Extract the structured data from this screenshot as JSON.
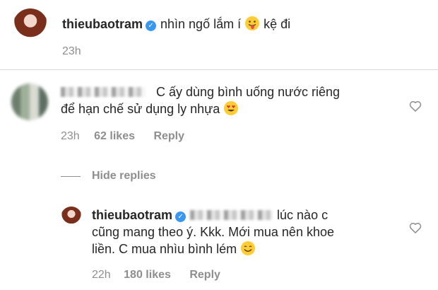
{
  "post_comment": {
    "username": "thieubaotram",
    "text_before_emoji": "nhìn ngố lắm í",
    "text_after_emoji": "kệ đi",
    "time": "23h"
  },
  "reply_comment": {
    "text_line1": "C ấy dùng bình uống nước riêng",
    "text_line2": "để hạn chế sử dụng ly nhựa",
    "time": "23h",
    "likes": "62 likes",
    "reply_label": "Reply",
    "hide_replies": "Hide replies"
  },
  "nested_reply": {
    "username": "thieubaotram",
    "text_line1_tail": "lúc nào c",
    "text_line2": "cũng mang theo ý. Kkk. Mới mua nên khoe",
    "text_line3": "liền. C mua nhìu bình lém",
    "time": "22h",
    "likes": "180 likes",
    "reply_label": "Reply"
  },
  "icons": {
    "verified": "✓",
    "heart": "heart-outline-icon",
    "emoji_tongue": "tongue-out-face",
    "emoji_heart_eyes": "heart-eyes-face",
    "emoji_smile": "smiling-face"
  },
  "colors": {
    "verified_blue": "#3897f0",
    "meta_gray": "#8e8e8e",
    "divider": "#dbdbdb",
    "emoji_yellow": "#ffcc33"
  }
}
